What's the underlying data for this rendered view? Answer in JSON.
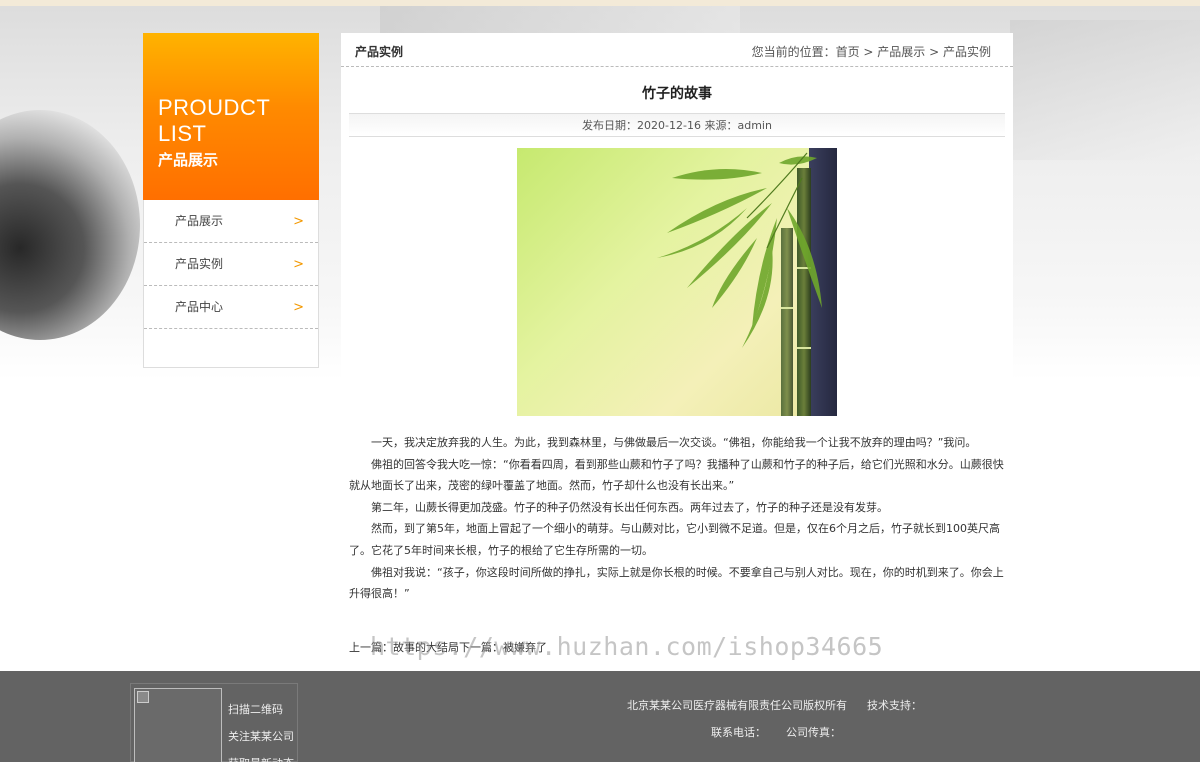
{
  "sidebar": {
    "banner_en": "PROUDCT LIST",
    "banner_cn": "产品展示",
    "items": [
      {
        "label": "产品展示"
      },
      {
        "label": "产品实例"
      },
      {
        "label": "产品中心"
      }
    ]
  },
  "main": {
    "section_title": "产品实例",
    "breadcrumb": {
      "prefix": "您当前的位置：",
      "home": "首页",
      "level1": "产品展示",
      "level2": "产品实例",
      "separator": " > "
    },
    "article": {
      "title": "竹子的故事",
      "meta": "发布日期：2020-12-16 来源：admin",
      "paragraphs": [
        "一天，我决定放弃我的人生。为此，我到森林里，与佛做最后一次交谈。“佛祖，你能给我一个让我不放弃的理由吗？”我问。",
        "佛祖的回答令我大吃一惊：“你看看四周，看到那些山蕨和竹子了吗？我播种了山蕨和竹子的种子后，给它们光照和水分。山蕨很快就从地面长了出来，茂密的绿叶覆盖了地面。然而，竹子却什么也没有长出来。”",
        "第二年，山蕨长得更加茂盛。竹子的种子仍然没有长出任何东西。两年过去了，竹子的种子还是没有发芽。",
        "然而，到了第5年，地面上冒起了一个细小的萌芽。与山蕨对比，它小到微不足道。但是，仅在6个月之后，竹子就长到100英尺高了。它花了5年时间来长根，竹子的根给了它生存所需的一切。",
        "佛祖对我说：“孩子，你这段时间所做的挣扎，实际上就是你长根的时候。不要拿自己与别人对比。现在，你的时机到来了。你会上升得很高！”"
      ],
      "prev_label": "上一篇：",
      "prev_title": "故事的大结局",
      "next_label": "下一篇：",
      "next_title": "被嫌弃了"
    },
    "watermark": "https://www.huzhan.com/ishop34665"
  },
  "footer": {
    "qr_lines": [
      "扫描二维码",
      "关注某某公司",
      "获取最新动态"
    ],
    "copyright": "北京某某公司医疗器械有限责任公司版权所有",
    "tech_support": "技术支持：",
    "phone": "联系电话：",
    "fax": "公司传真："
  },
  "colors": {
    "accent": "#ff8a00",
    "arrow": "#f39800",
    "footer_bg": "#636363"
  }
}
